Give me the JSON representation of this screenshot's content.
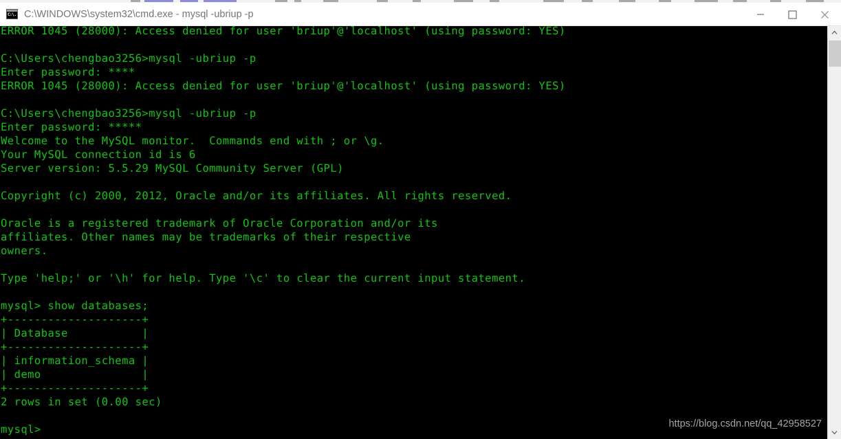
{
  "window": {
    "title": "C:\\WINDOWS\\system32\\cmd.exe - mysql  -ubriup -p",
    "icon_name": "cmd-exe-icon",
    "icon_text": "C:\\.",
    "controls": {
      "minimize_label": "Minimize",
      "maximize_label": "Maximize",
      "close_label": "Close"
    },
    "colors": {
      "titlebar_bg": "#ffffff",
      "titlebar_text": "#767676",
      "console_bg": "#000000",
      "console_text": "#13c413",
      "scrollbar_track": "#f0f0f0",
      "scrollbar_thumb": "#cdcdcd"
    }
  },
  "console": {
    "lines": [
      "ERROR 1045 (28000): Access denied for user 'briup'@'localhost' (using password: YES)",
      "",
      "C:\\Users\\chengbao3256>mysql -ubriup -p",
      "Enter password: ****",
      "ERROR 1045 (28000): Access denied for user 'briup'@'localhost' (using password: YES)",
      "",
      "C:\\Users\\chengbao3256>mysql -ubriup -p",
      "Enter password: *****",
      "Welcome to the MySQL monitor.  Commands end with ; or \\g.",
      "Your MySQL connection id is 6",
      "Server version: 5.5.29 MySQL Community Server (GPL)",
      "",
      "Copyright (c) 2000, 2012, Oracle and/or its affiliates. All rights reserved.",
      "",
      "Oracle is a registered trademark of Oracle Corporation and/or its",
      "affiliates. Other names may be trademarks of their respective",
      "owners.",
      "",
      "Type 'help;' or '\\h' for help. Type '\\c' to clear the current input statement.",
      "",
      "mysql> show databases;",
      "+--------------------+",
      "| Database           |",
      "+--------------------+",
      "| information_schema |",
      "| demo               |",
      "+--------------------+",
      "2 rows in set (0.00 sec)",
      "",
      "mysql>"
    ],
    "prompt_user_path": "C:\\Users\\chengbao3256",
    "command": "mysql -ubriup -p",
    "mysql_prompt": "mysql>",
    "query": "show databases;",
    "result_table": {
      "header": "Database",
      "rows": [
        "information_schema",
        "demo"
      ],
      "footer": "2 rows in set (0.00 sec)",
      "row_count": 2,
      "duration_sec": "0.00"
    },
    "server_version": "5.5.29 MySQL Community Server (GPL)",
    "connection_id": "6"
  },
  "watermark": {
    "text": "https://blog.csdn.net/qq_42958527"
  },
  "scrollbar": {
    "up_arrow": "scroll-up-icon",
    "down_arrow": "scroll-down-icon",
    "thumb": "scroll-thumb"
  }
}
